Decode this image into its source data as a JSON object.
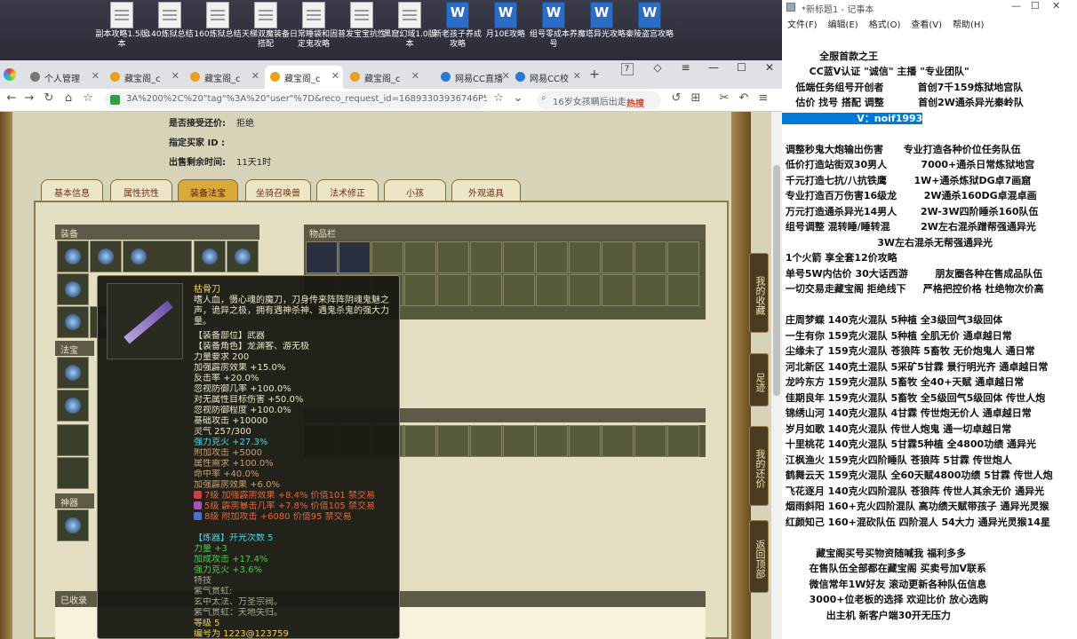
{
  "desktop": {
    "icons": [
      {
        "label": "副本攻略1.5版本",
        "type": "txt"
      },
      {
        "label": "140炼狱总结",
        "type": "txt"
      },
      {
        "label": "160炼狱总结",
        "type": "txt"
      },
      {
        "label": "天梯双魔装备搭配",
        "type": "txt"
      },
      {
        "label": "日常睡袋和固定鬼攻略",
        "type": "txt"
      },
      {
        "label": "普发宝宝抗性",
        "type": "txt"
      },
      {
        "label": "黑窟幻域1.0版本",
        "type": "txt"
      },
      {
        "label": "新老孩子养成攻略",
        "type": "word"
      },
      {
        "label": "月10E攻略",
        "type": "word"
      },
      {
        "label": "组号零成本养号",
        "type": "word"
      },
      {
        "label": "魔塔异光攻略",
        "type": "word"
      },
      {
        "label": "秦陵盗宫攻略",
        "type": "word"
      }
    ]
  },
  "browser": {
    "tabs": [
      {
        "label": "个人管理",
        "active": false
      },
      {
        "label": "藏宝阁_c",
        "active": false
      },
      {
        "label": "藏宝阁_c",
        "active": false
      },
      {
        "label": "藏宝阁_c",
        "active": true
      },
      {
        "label": "藏宝阁_c",
        "active": false
      },
      {
        "label": "网易CC直播",
        "active": false
      },
      {
        "label": "网易CC校",
        "active": false
      }
    ],
    "new_tab": "+",
    "tab_count": "7",
    "url": "3A%200%2C%20\"tag\"%3A%20\"user\"%7D&reco_request_id=16893303936746P5Ru",
    "search_text": "16岁女孩瞒后出走",
    "hot_label": "热搜"
  },
  "game": {
    "info_rows": [
      {
        "label": "是否接受还价:",
        "value": "拒绝"
      },
      {
        "label": "指定买家 ID :",
        "value": ""
      },
      {
        "label": "出售剩余时间:",
        "value": "11天1时"
      }
    ],
    "tabs": [
      "基本信息",
      "属性抗性",
      "装备法宝",
      "坐骑召唤兽",
      "法术修正",
      "小孩",
      "外观道具"
    ],
    "active_tab": "装备法宝",
    "equip_label": "装备",
    "fabao_label": "法宝",
    "inventory_label": "物品栏",
    "shenqi_label": "神器",
    "collected_label": "已收录",
    "sidebar": [
      "我的收藏",
      "足迹",
      "我的还价",
      "返回顶部"
    ],
    "tooltip": {
      "name": "枯骨刀",
      "description": "嗜人血，慑心魂的魔刀，刀身传来阵阵阴魂鬼魅之声，诡异之极，拥有遇神杀神、遇鬼杀鬼的强大力量。",
      "lines": [
        {
          "text": "【装备部位】武器",
          "color": "#ece6c6"
        },
        {
          "text": "【装备角色】龙渊客、游无极",
          "color": "#ece6c6"
        },
        {
          "text": "力量要求 200",
          "color": "#ece6c6"
        },
        {
          "text": "加强霹雳效果 +15.0%",
          "color": "#ece6c6"
        },
        {
          "text": "反击率 +20.0%",
          "color": "#ece6c6"
        },
        {
          "text": "忽视防御几率 +100.0%",
          "color": "#ece6c6"
        },
        {
          "text": "对无属性目标伤害 +50.0%",
          "color": "#ece6c6"
        },
        {
          "text": "忽视防御程度 +100.0%",
          "color": "#ece6c6"
        },
        {
          "text": "基础攻击 +10000",
          "color": "#ece6c6"
        },
        {
          "text": "灵气 257/300",
          "color": "#ece6c6"
        },
        {
          "text": "强力克火 +27.3%",
          "color": "#4ad8e8"
        },
        {
          "text": "附加攻击 +5000",
          "color": "#c8a070"
        },
        {
          "text": "属性需求 +100.0%",
          "color": "#c8a070"
        },
        {
          "text": "命中率 +40.0%",
          "color": "#c8a070"
        },
        {
          "text": "加强霹雳效果 +6.0%",
          "color": "#c8a070"
        },
        {
          "text": "7级 加强霹雳效果 +8.4% 价值101 禁交易",
          "color": "#e06a3a",
          "gem": "#d04040"
        },
        {
          "text": "5级 霹雳暴击几率 +7.8% 价值105 禁交易",
          "color": "#e06a3a",
          "gem": "#b050c0"
        },
        {
          "text": "8级 附加攻击 +6080 价值95 禁交易",
          "color": "#e06a3a",
          "gem": "#4a70d0"
        },
        {
          "text": "",
          "color": "#ece6c6"
        },
        {
          "text": "【炼器】开光次数 5",
          "color": "#4ad8e8"
        },
        {
          "text": "力量 +3",
          "color": "#50c850"
        },
        {
          "text": "加成攻击 +17.4%",
          "color": "#50c850"
        },
        {
          "text": "强力克火 +3.6%",
          "color": "#50c850"
        },
        {
          "text": "特技",
          "color": "#a8a890"
        },
        {
          "text": "紫气贯虹:",
          "color": "#a8a890"
        },
        {
          "text": "玄中太法、万圣宗阀。",
          "color": "#a8a890"
        },
        {
          "text": "紫气贯虹：天地失归。",
          "color": "#a8a890"
        },
        {
          "text": "等级 5",
          "color": "#f0d060"
        },
        {
          "text": "编号为 1223@123759",
          "color": "#f0d060"
        }
      ]
    }
  },
  "notepad": {
    "title": "*新标题1 - 记事本",
    "menu": [
      "文件(F)",
      "编辑(E)",
      "格式(O)",
      "查看(V)",
      "帮助(H)"
    ],
    "lines": [
      "",
      "           全服首款之王",
      "        CC蓝V认证 \"诚信\" 主播 \"专业团队\"",
      "    低端任务组号开创者          首创7千159炼狱地宫队",
      "    估价 找号 搭配 调整          首创2W通杀异光秦岭队",
      "                      V：noif1993",
      "",
      " 调整秒鬼大炮输出伤害      专业打造各种价位任务队伍",
      " 低价打造站街双30男人          7000+通杀日常炼狱地宫",
      " 千元打造七抗/八抗铁鹰        1W+通杀炼狱DG卓7画窟",
      " 专业打造百万伤害16级龙        2W通杀160DG卓混卓画",
      " 万元打造通杀异光14男人       2W-3W四阶睡杀160队伍",
      " 组号调整 混转睡/睡转混         2W左右混杀蹭帮强通异光",
      "                            3W左右混杀无帮强通异光",
      " 1个火箭 享全套12价攻略",
      " 单号5W内估价 30大话西游        朋友圈各种在售成品队伍",
      " 一切交易走藏宝阁 拒绝线下     严格把控价格 杜绝物次价高",
      "",
      " 庄周梦蝶 140克火混队 5种植 全3级回气3级回体",
      " 一生有你 159克火混队 5种植 全肌无价 通卓越日常",
      " 尘缘未了 159克火混队 苍狼阵 5畜牧 无价炮鬼人 通日常",
      " 河北新区 140克土混队 5采矿5甘霖 景行明光齐 通卓越日常",
      " 龙吟东方 159克火混队 5畜牧 全40+天赋 通卓越日常",
      " 佳期良年 159克火混队 5畜牧 全5级回气5级回体 传世人炮",
      " 锦绣山河 140克火混队 4甘霖 传世炮无价人 通卓越日常",
      " 岁月如歌 140克火混队 传世人炮鬼 通一切卓越日常",
      " 十里桃花 140克火混队 5甘霖5种植 全4800功绩 通异光",
      " 江枫渔火 159克火四阶睡队 苍狼阵 5甘霖 传世炮人",
      " 鹤舞云天 159克火混队 全60天赋4800功绩 5甘霖 传世人炮",
      " 飞花逐月 140克火四阶混队 苍狼阵 传世人其余无价 通异光",
      " 烟雨斜阳 160+克火四阶混队 高功绩天赋带孩子 通异光灵猴",
      " 红颜知己 160+混砍队伍 四阶混人 54大力 通异光灵猴14星",
      "",
      "          藏宝阁买号买物资随喊我 福利多多",
      "        在售队伍全部都在藏宝阁 买卖号加V联系",
      "        微信常年1W好友 滚动更新各种队伍信息",
      "        3000+位老板的选择 欢迎比价 放心选购",
      "             出主机 新客户端30开无压力"
    ],
    "highlight_line": 5
  }
}
